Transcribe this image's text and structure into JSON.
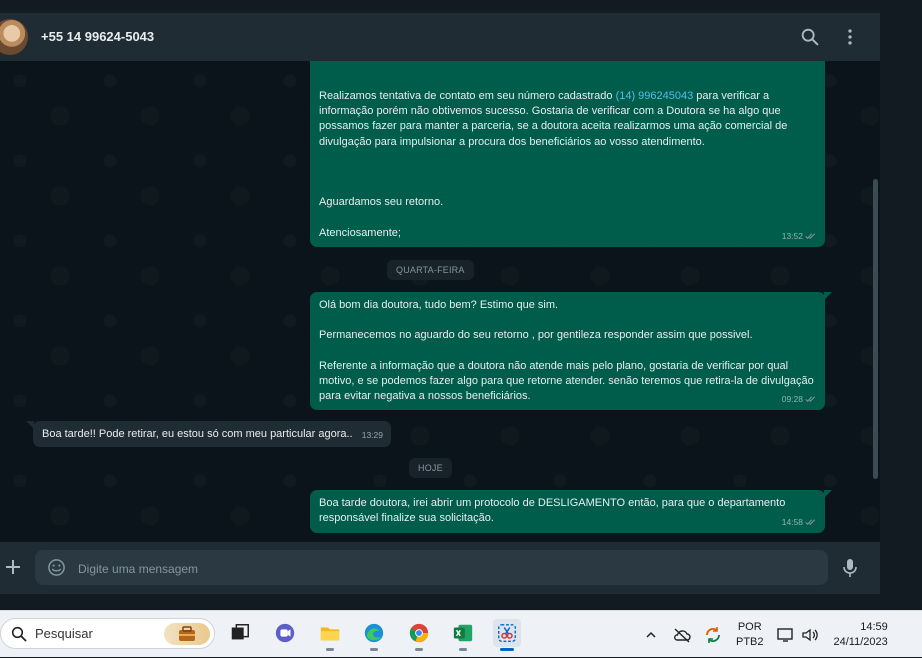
{
  "header": {
    "contact_name": "+55 14 99624-5043"
  },
  "messages": {
    "m1": {
      "p1_before": "Realizamos tentativa de contato em seu número cadastrado ",
      "p1_link": "(14) 996245043",
      "p1_after": " para verificar a informação porém não obtivemos sucesso. Gostaria de verificar com a Doutora se ha algo que possamos fazer para manter a parceria, se a doutora aceita realizarmos uma ação comercial de divulgação para impulsionar a procura dos beneficiários ao vosso atendimento.",
      "p2": "Aguardamos seu retorno.",
      "p3": "Atenciosamente;",
      "time": "13:52"
    },
    "divider1": "QUARTA-FEIRA",
    "m2": {
      "p1": "Olá bom dia doutora, tudo bem? Estimo que sim.",
      "p2": "Permanecemos no aguardo do seu retorno , por gentileza responder assim que possivel.",
      "p3": "Referente a informação que a doutora não atende mais pelo plano, gostaria de verificar por qual motivo, e se podemos fazer algo para que retorne atender. senão teremos que retira-la de divulgação para evitar negativa a nossos beneficiários.",
      "time": "09:28"
    },
    "m3": {
      "text": "Boa tarde!! Pode retirar, eu estou só com meu particular agora..",
      "time": "13:29"
    },
    "divider2": "HOJE",
    "m4": {
      "text": "Boa tarde doutora, irei abrir um protocolo de DESLIGAMENTO então, para que o departamento responsável finalize sua solicitação.",
      "time": "14:58"
    }
  },
  "composer": {
    "placeholder": "Digite uma mensagem"
  },
  "taskbar": {
    "search_label": "Pesquisar",
    "lang_line1": "POR",
    "lang_line2": "PTB2",
    "time": "14:59",
    "date": "24/11/2023"
  },
  "colors": {
    "outgoing_bubble": "#005c4b",
    "incoming_bubble": "#202c33",
    "chat_background": "#0b141a",
    "link": "#53bdeb"
  },
  "icons": [
    "search-icon",
    "menu-dots-icon",
    "plus-icon",
    "emoji-icon",
    "microphone-icon"
  ]
}
